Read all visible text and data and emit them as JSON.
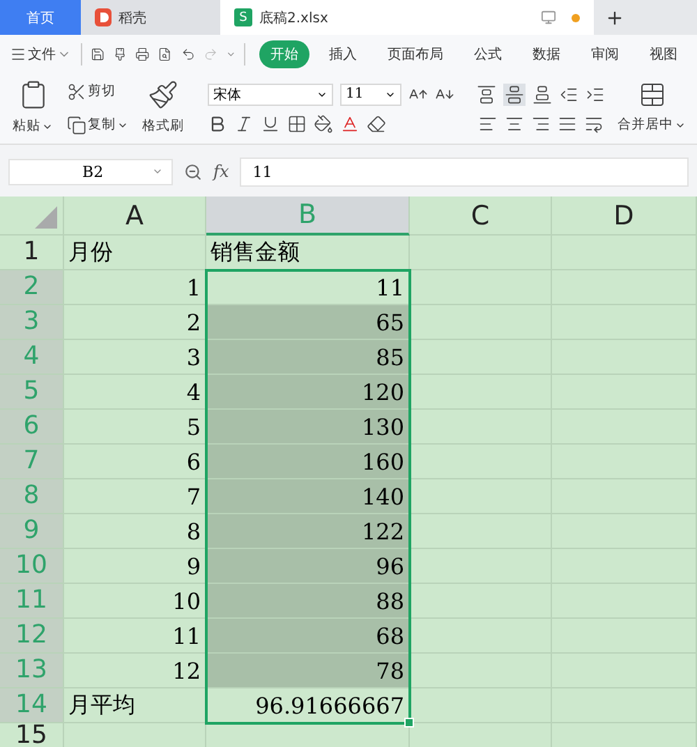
{
  "tabs": [
    {
      "kind": "home",
      "label": "首页",
      "selected": false
    },
    {
      "kind": "docer",
      "label": "稻壳",
      "selected": false
    },
    {
      "kind": "sheet",
      "badge": "S",
      "label": "底稿2.xlsx",
      "selected": true
    }
  ],
  "menu": {
    "file": "文件",
    "ribbon_tabs": [
      {
        "label": "开始",
        "selected": true
      },
      {
        "label": "插入",
        "selected": false
      },
      {
        "label": "页面布局",
        "selected": false
      },
      {
        "label": "公式",
        "selected": false
      },
      {
        "label": "数据",
        "selected": false
      },
      {
        "label": "审阅",
        "selected": false
      },
      {
        "label": "视图",
        "selected": false
      }
    ]
  },
  "ribbon": {
    "paste": "粘贴",
    "cut": "剪切",
    "copy": "复制",
    "format_painter": "格式刷",
    "font": "宋体",
    "font_size": "11",
    "merge": "合并居中"
  },
  "formula_bar": {
    "name_box": "B2",
    "fx": "fx",
    "formula": "11"
  },
  "columns": [
    {
      "label": "A",
      "selected": false
    },
    {
      "label": "B",
      "selected": true
    },
    {
      "label": "C",
      "selected": false
    },
    {
      "label": "D",
      "selected": false
    }
  ],
  "rows": [
    {
      "number": "1",
      "a": "月份",
      "b": "销售金额",
      "selected": false,
      "highlighted": false
    },
    {
      "number": "2",
      "a": "1",
      "b": "11",
      "selected": true,
      "highlighted": false
    },
    {
      "number": "3",
      "a": "2",
      "b": "65",
      "selected": true,
      "highlighted": true
    },
    {
      "number": "4",
      "a": "3",
      "b": "85",
      "selected": true,
      "highlighted": true
    },
    {
      "number": "5",
      "a": "4",
      "b": "120",
      "selected": true,
      "highlighted": true
    },
    {
      "number": "6",
      "a": "5",
      "b": "130",
      "selected": true,
      "highlighted": true
    },
    {
      "number": "7",
      "a": "6",
      "b": "160",
      "selected": true,
      "highlighted": true
    },
    {
      "number": "8",
      "a": "7",
      "b": "140",
      "selected": true,
      "highlighted": true
    },
    {
      "number": "9",
      "a": "8",
      "b": "122",
      "selected": true,
      "highlighted": true
    },
    {
      "number": "10",
      "a": "9",
      "b": "96",
      "selected": true,
      "highlighted": true
    },
    {
      "number": "11",
      "a": "10",
      "b": "88",
      "selected": true,
      "highlighted": true
    },
    {
      "number": "12",
      "a": "11",
      "b": "68",
      "selected": true,
      "highlighted": true
    },
    {
      "number": "13",
      "a": "12",
      "b": "78",
      "selected": true,
      "highlighted": true
    },
    {
      "number": "14",
      "a": "月平均",
      "b": "96.91666667",
      "selected": true,
      "highlighted": false
    },
    {
      "number": "15",
      "a": "",
      "b": "",
      "selected": false,
      "highlighted": false
    }
  ]
}
